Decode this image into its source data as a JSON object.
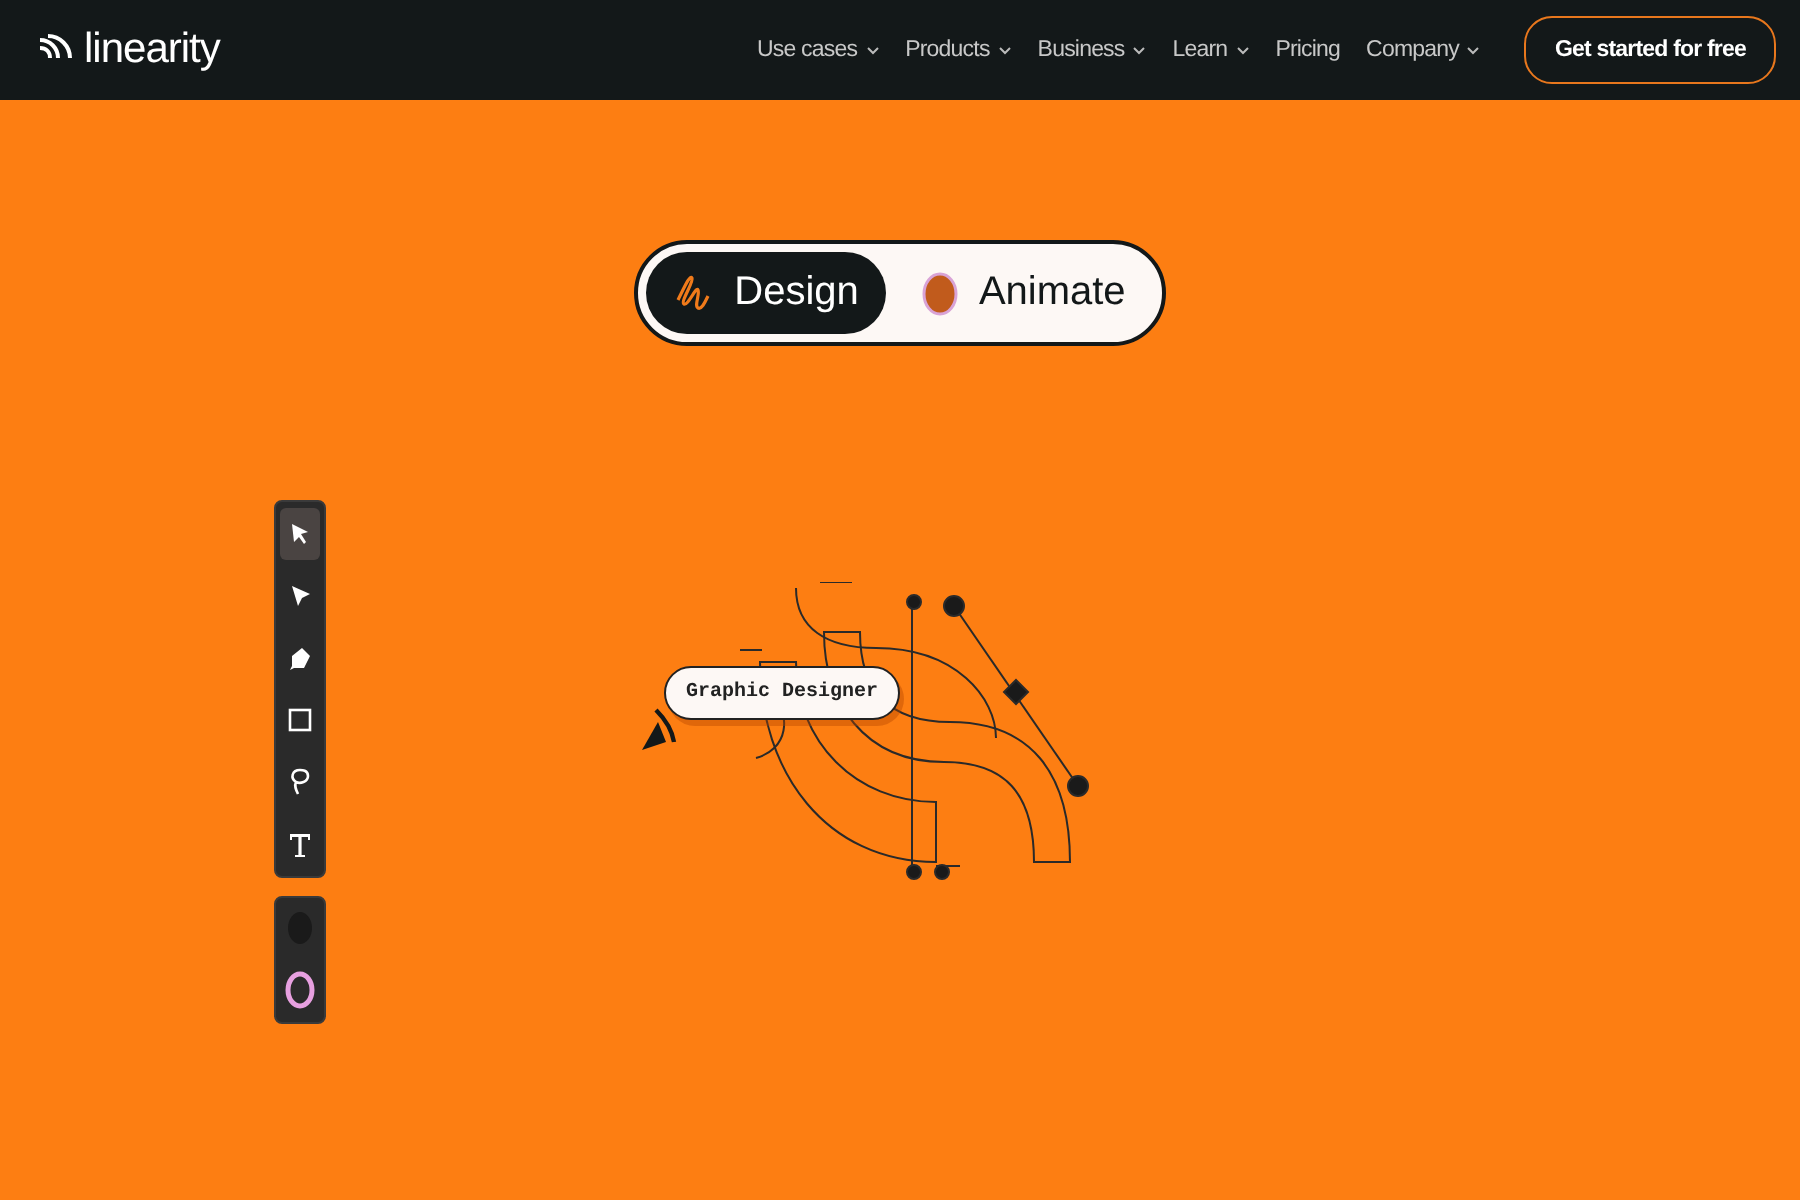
{
  "header": {
    "logo": "linearity",
    "nav": [
      {
        "label": "Use cases",
        "dropdown": true
      },
      {
        "label": "Products",
        "dropdown": true
      },
      {
        "label": "Business",
        "dropdown": true
      },
      {
        "label": "Learn",
        "dropdown": true
      },
      {
        "label": "Pricing",
        "dropdown": false
      },
      {
        "label": "Company",
        "dropdown": true
      }
    ],
    "cta": "Get started for free"
  },
  "mode_toggle": [
    {
      "label": "Design",
      "kind": "design",
      "selected": true
    },
    {
      "label": "Animate",
      "kind": "animate",
      "selected": false
    }
  ],
  "toolbar": {
    "tools": [
      {
        "kind": "select",
        "selected": true
      },
      {
        "kind": "direct",
        "selected": false
      },
      {
        "kind": "pen",
        "selected": false
      },
      {
        "kind": "rect",
        "selected": false
      },
      {
        "kind": "lasso",
        "selected": false
      },
      {
        "kind": "text",
        "selected": false
      }
    ]
  },
  "canvas": {
    "label": "Graphic Designer"
  }
}
